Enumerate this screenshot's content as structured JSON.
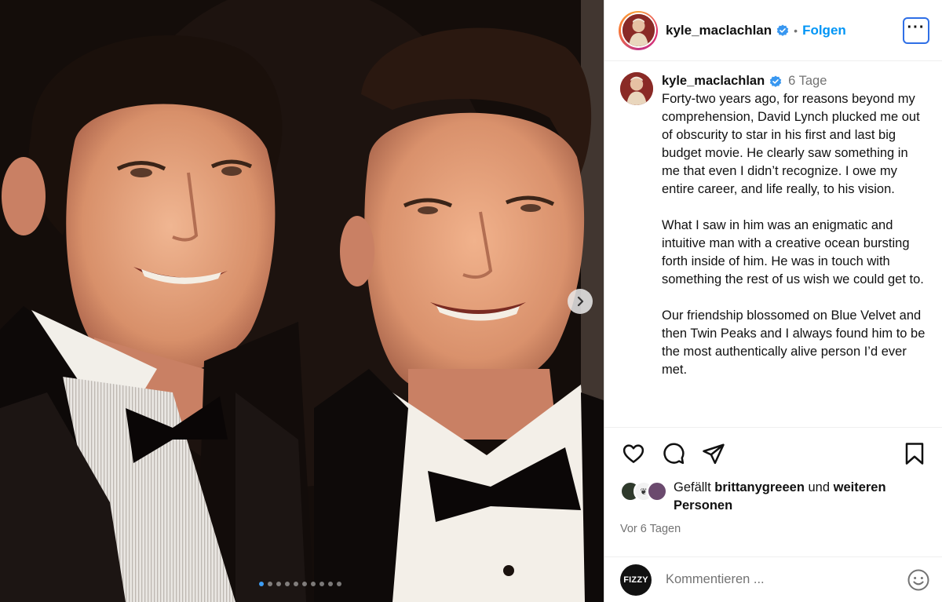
{
  "post": {
    "username": "kyle_maclachlan",
    "verified": true,
    "separator": "•",
    "follow_label": "Folgen",
    "more_label": "···",
    "carousel": {
      "count": 10,
      "active_index": 0
    }
  },
  "caption": {
    "username": "kyle_maclachlan",
    "time": "6 Tage",
    "paragraphs": [
      "Forty-two years ago, for reasons beyond my comprehension, David Lynch plucked me out of obscurity to star in his first and last big budget movie. He clearly saw something in me that even I didn’t recognize. I owe my entire career, and life really, to his vision.",
      "What I saw in him was an enigmatic and intuitive man with a creative ocean bursting forth inside of him. He was in touch with something the rest of us wish we could get to.",
      "Our friendship blossomed on Blue Velvet and then Twin Peaks and I always found him to be the most authentically alive person I’d ever met."
    ]
  },
  "actions": {
    "like_icon": "heart-icon",
    "comment_icon": "comment-icon",
    "share_icon": "send-icon",
    "save_icon": "bookmark-icon"
  },
  "likes": {
    "prefix": "Gefällt",
    "user": "brittanygreeen",
    "middle": "und",
    "suffix": "weiteren Personen"
  },
  "timeago": "Vor 6 Tagen",
  "comment": {
    "avatar_label": "FIZZY",
    "placeholder": "Kommentieren ..."
  },
  "colors": {
    "accent": "#0095f6",
    "verified": "#3897f0",
    "muted": "#737373"
  }
}
